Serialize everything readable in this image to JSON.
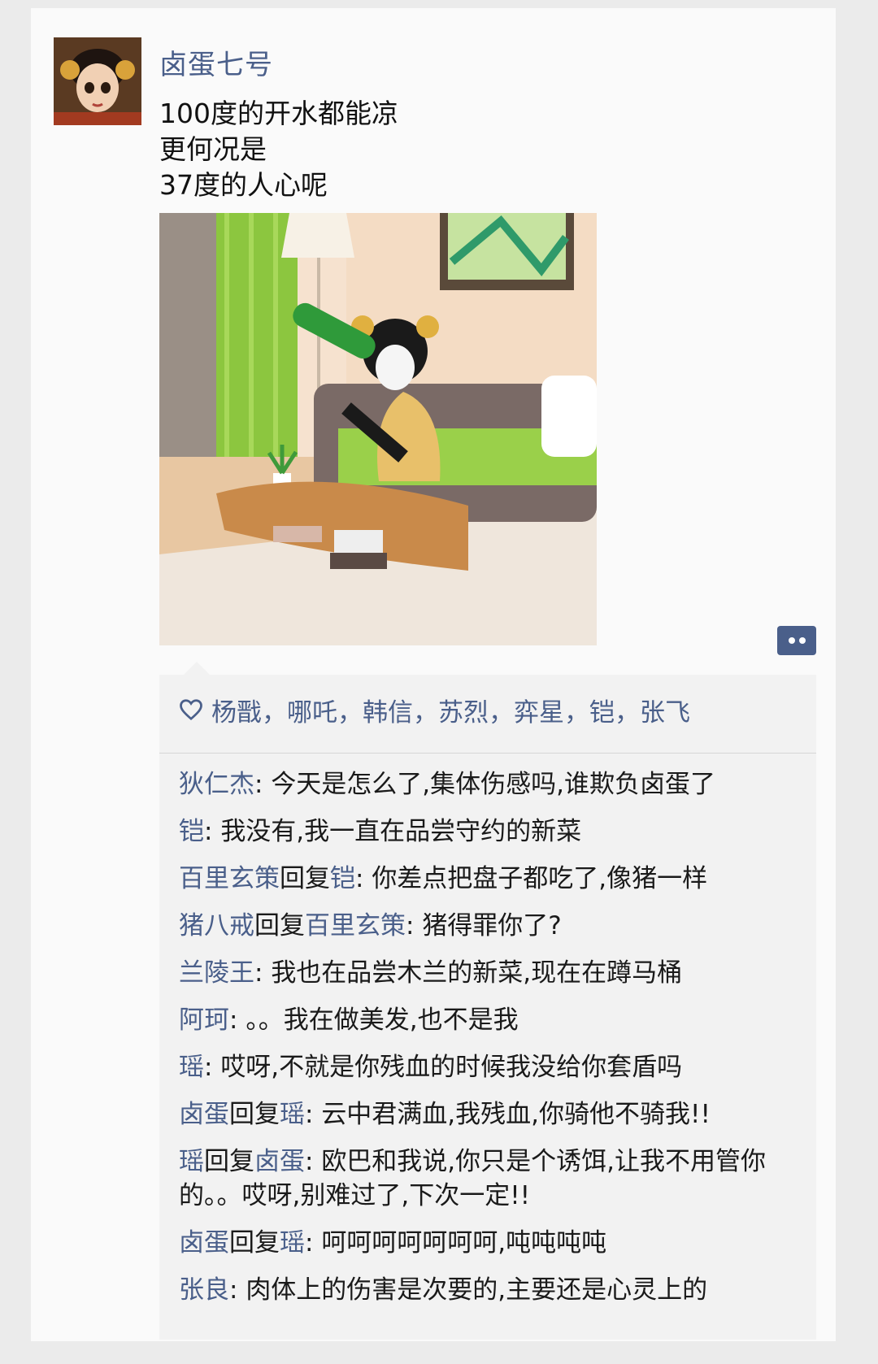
{
  "post": {
    "author": "卤蛋七号",
    "text_lines": [
      "100度的开水都能凉",
      "更何况是",
      "37度的人心呢"
    ]
  },
  "likes": {
    "names": "杨戬，哪吒，韩信，苏烈，弈星，铠，张飞"
  },
  "icons": {
    "heart": "heart-outline-icon",
    "more": "more-dots-icon"
  },
  "colors": {
    "name_link": "#4a5f8a",
    "panel_bg": "#f2f2f2"
  },
  "comments": [
    {
      "from": "狄仁杰",
      "reply_label": "",
      "to": "",
      "sep": ": ",
      "text": "今天是怎么了,集体伤感吗,谁欺负卤蛋了"
    },
    {
      "from": "铠",
      "reply_label": "",
      "to": "",
      "sep": ": ",
      "text": "我没有,我一直在品尝守约的新菜"
    },
    {
      "from": "百里玄策",
      "reply_label": "回复",
      "to": "铠",
      "sep": ": ",
      "text": "你差点把盘子都吃了,像猪一样"
    },
    {
      "from": "猪八戒",
      "reply_label": "回复",
      "to": "百里玄策",
      "sep": ": ",
      "text": "猪得罪你了?"
    },
    {
      "from": "兰陵王",
      "reply_label": "",
      "to": "",
      "sep": ": ",
      "text": "我也在品尝木兰的新菜,现在在蹲马桶"
    },
    {
      "from": "阿珂",
      "reply_label": "",
      "to": "",
      "sep": ": ",
      "text": "。。我在做美发,也不是我"
    },
    {
      "from": "瑶",
      "reply_label": "",
      "to": "",
      "sep": ": ",
      "text": "哎呀,不就是你残血的时候我没给你套盾吗"
    },
    {
      "from": "卤蛋",
      "reply_label": "回复",
      "to": "瑶",
      "sep": ": ",
      "text": "云中君满血,我残血,你骑他不骑我!!"
    },
    {
      "from": "瑶",
      "reply_label": "回复",
      "to": "卤蛋",
      "sep": ": ",
      "text": "欧巴和我说,你只是个诱饵,让我不用管你的。。哎呀,别难过了,下次一定!!"
    },
    {
      "from": "卤蛋",
      "reply_label": "回复",
      "to": "瑶",
      "sep": ": ",
      "text": "呵呵呵呵呵呵呵,吨吨吨吨"
    },
    {
      "from": "张良",
      "reply_label": "",
      "to": "",
      "sep": ": ",
      "text": "肉体上的伤害是次要的,主要还是心灵上的"
    }
  ]
}
